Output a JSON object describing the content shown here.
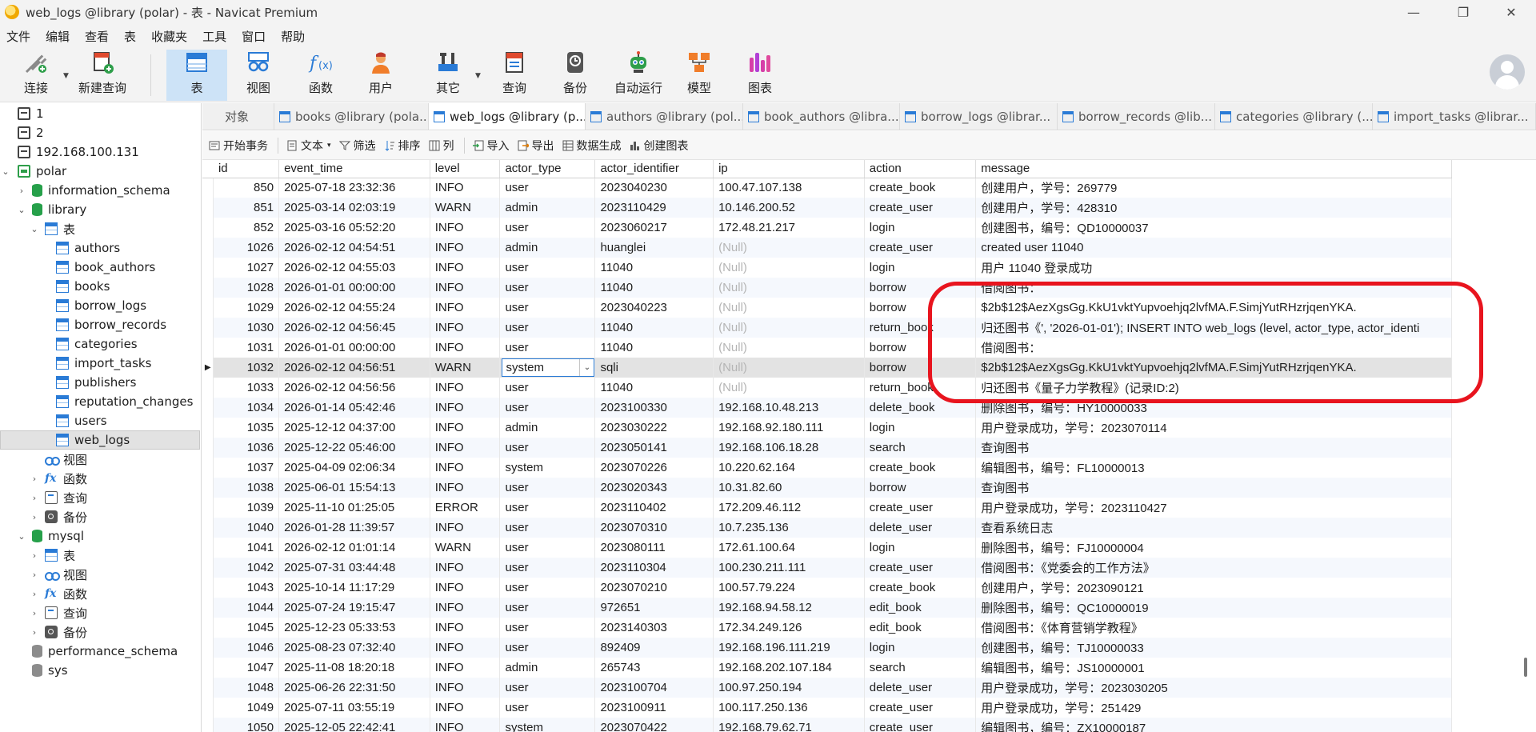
{
  "window": {
    "title": "web_logs @library (polar) - 表 - Navicat Premium",
    "controls": [
      "—",
      "❐",
      "✕"
    ]
  },
  "menu": [
    "文件",
    "编辑",
    "查看",
    "表",
    "收藏夹",
    "工具",
    "窗口",
    "帮助"
  ],
  "toolbar": {
    "items": [
      {
        "label": "连接",
        "icon": "plug-icon"
      },
      {
        "label": "新建查询",
        "icon": "new-query-icon"
      },
      {
        "label": "表",
        "icon": "table-icon"
      },
      {
        "label": "视图",
        "icon": "view-icon"
      },
      {
        "label": "函数",
        "icon": "function-icon"
      },
      {
        "label": "用户",
        "icon": "user-icon"
      },
      {
        "label": "其它",
        "icon": "tools-icon"
      },
      {
        "label": "查询",
        "icon": "query-icon"
      },
      {
        "label": "备份",
        "icon": "backup-icon"
      },
      {
        "label": "自动运行",
        "icon": "robot-icon"
      },
      {
        "label": "模型",
        "icon": "model-icon"
      },
      {
        "label": "图表",
        "icon": "chart-icon"
      }
    ],
    "active": "表"
  },
  "sidebar": {
    "connections": [
      "1",
      "2",
      "192.168.100.131",
      "polar"
    ],
    "polar_dbs": [
      "information_schema",
      "library"
    ],
    "library_children": {
      "tables_label": "表",
      "tables": [
        "authors",
        "book_authors",
        "books",
        "borrow_logs",
        "borrow_records",
        "categories",
        "import_tasks",
        "publishers",
        "reputation_changes",
        "users",
        "web_logs"
      ],
      "views_label": "视图",
      "functions_label": "函数",
      "queries_label": "查询",
      "backups_label": "备份"
    },
    "mysql": {
      "label": "mysql",
      "children": [
        "表",
        "视图",
        "函数",
        "查询",
        "备份"
      ]
    },
    "other_dbs": [
      "performance_schema",
      "sys"
    ],
    "selected": "web_logs"
  },
  "tabs": [
    {
      "label": "对象"
    },
    {
      "label": "books @library (pola..."
    },
    {
      "label": "web_logs @library (p..."
    },
    {
      "label": "authors @library (pol..."
    },
    {
      "label": "book_authors @libra..."
    },
    {
      "label": "borrow_logs @librar..."
    },
    {
      "label": "borrow_records @lib..."
    },
    {
      "label": "categories @library (..."
    },
    {
      "label": "import_tasks @librar..."
    }
  ],
  "actionbar": [
    "开始事务",
    "文本",
    "筛选",
    "排序",
    "列",
    "导入",
    "导出",
    "数据生成",
    "创建图表"
  ],
  "grid": {
    "columns": [
      "id",
      "event_time",
      "level",
      "actor_type",
      "actor_identifier",
      "ip",
      "action",
      "message"
    ],
    "current_row": 9,
    "rows": [
      [
        "850",
        "2025-07-18 23:32:36",
        "INFO",
        "user",
        "2023040230",
        "100.47.107.138",
        "create_book",
        "创建用户，学号：269779"
      ],
      [
        "851",
        "2025-03-14 02:03:19",
        "WARN",
        "admin",
        "2023110429",
        "10.146.200.52",
        "create_user",
        "创建用户，学号：428310"
      ],
      [
        "852",
        "2025-03-16 05:52:20",
        "INFO",
        "user",
        "2023060217",
        "172.48.21.217",
        "login",
        "创建图书，编号：QD10000037"
      ],
      [
        "1026",
        "2026-02-12 04:54:51",
        "INFO",
        "admin",
        "huanglei",
        "(Null)",
        "create_user",
        "created user 11040"
      ],
      [
        "1027",
        "2026-02-12 04:55:03",
        "INFO",
        "user",
        "11040",
        "(Null)",
        "login",
        "用户 11040 登录成功"
      ],
      [
        "1028",
        "2026-01-01 00:00:00",
        "INFO",
        "user",
        "11040",
        "(Null)",
        "borrow",
        "借阅图书："
      ],
      [
        "1029",
        "2026-02-12 04:55:24",
        "INFO",
        "user",
        "2023040223",
        "(Null)",
        "borrow",
        "$2b$12$AezXgsGg.KkU1vktYupvoehjq2lvfMA.F.SimjYutRHzrjqenYKA."
      ],
      [
        "1030",
        "2026-02-12 04:56:45",
        "INFO",
        "user",
        "11040",
        "(Null)",
        "return_book",
        "归还图书《', '2026-01-01'); INSERT INTO web_logs (level, actor_type, actor_identi"
      ],
      [
        "1031",
        "2026-01-01 00:00:00",
        "INFO",
        "user",
        "11040",
        "(Null)",
        "borrow",
        "借阅图书："
      ],
      [
        "1032",
        "2026-02-12 04:56:51",
        "WARN",
        "system",
        "sqli",
        "(Null)",
        "borrow",
        "$2b$12$AezXgsGg.KkU1vktYupvoehjq2lvfMA.F.SimjYutRHzrjqenYKA."
      ],
      [
        "1033",
        "2026-02-12 04:56:56",
        "INFO",
        "user",
        "11040",
        "(Null)",
        "return_book",
        "归还图书《量子力学教程》(记录ID:2)"
      ],
      [
        "1034",
        "2026-01-14 05:42:46",
        "INFO",
        "user",
        "2023100330",
        "192.168.10.48.213",
        "delete_book",
        "删除图书，编号：HY10000033"
      ],
      [
        "1035",
        "2025-12-12 04:37:00",
        "INFO",
        "admin",
        "2023030222",
        "192.168.92.180.111",
        "login",
        "用户登录成功，学号：2023070114"
      ],
      [
        "1036",
        "2025-12-22 05:46:00",
        "INFO",
        "user",
        "2023050141",
        "192.168.106.18.28",
        "search",
        "查询图书"
      ],
      [
        "1037",
        "2025-04-09 02:06:34",
        "INFO",
        "system",
        "2023070226",
        "10.220.62.164",
        "create_book",
        "编辑图书，编号：FL10000013"
      ],
      [
        "1038",
        "2025-06-01 15:54:13",
        "INFO",
        "user",
        "2023020343",
        "10.31.82.60",
        "borrow",
        "查询图书"
      ],
      [
        "1039",
        "2025-11-10 01:25:05",
        "ERROR",
        "user",
        "2023110402",
        "172.209.46.112",
        "create_user",
        "用户登录成功，学号：2023110427"
      ],
      [
        "1040",
        "2026-01-28 11:39:57",
        "INFO",
        "user",
        "2023070310",
        "10.7.235.136",
        "delete_user",
        "查看系统日志"
      ],
      [
        "1041",
        "2026-02-12 01:01:14",
        "WARN",
        "user",
        "2023080111",
        "172.61.100.64",
        "login",
        "删除图书，编号：FJ10000004"
      ],
      [
        "1042",
        "2025-07-31 03:44:48",
        "INFO",
        "user",
        "2023110304",
        "100.230.211.111",
        "create_user",
        "借阅图书：《党委会的工作方法》"
      ],
      [
        "1043",
        "2025-10-14 11:17:29",
        "INFO",
        "user",
        "2023070210",
        "100.57.79.224",
        "create_book",
        "创建用户，学号：2023090121"
      ],
      [
        "1044",
        "2025-07-24 19:15:47",
        "INFO",
        "user",
        "972651",
        "192.168.94.58.12",
        "edit_book",
        "删除图书，编号：QC10000019"
      ],
      [
        "1045",
        "2025-12-23 05:33:53",
        "INFO",
        "user",
        "2023140303",
        "172.34.249.126",
        "edit_book",
        "借阅图书：《体育营销学教程》"
      ],
      [
        "1046",
        "2025-08-23 07:32:40",
        "INFO",
        "user",
        "892409",
        "192.168.196.111.219",
        "login",
        "创建图书，编号：TJ10000033"
      ],
      [
        "1047",
        "2025-11-08 18:20:18",
        "INFO",
        "admin",
        "265743",
        "192.168.202.107.184",
        "search",
        "编辑图书，编号：JS10000001"
      ],
      [
        "1048",
        "2025-06-26 22:31:50",
        "INFO",
        "user",
        "2023100704",
        "100.97.250.194",
        "delete_user",
        "用户登录成功，学号：2023030205"
      ],
      [
        "1049",
        "2025-07-11 03:55:19",
        "INFO",
        "user",
        "2023100911",
        "100.117.250.136",
        "create_user",
        "用户登录成功，学号：251429"
      ],
      [
        "1050",
        "2025-12-05 22:42:41",
        "INFO",
        "system",
        "2023070422",
        "192.168.79.62.71",
        "create_user",
        "编辑图书，编号：ZX10000187"
      ]
    ]
  },
  "colors": {
    "highlight": "#e8141e",
    "accent": "#2a7bd6",
    "null_text": "#b5b5b5",
    "selected_tab_bg": "#cde3f7"
  }
}
